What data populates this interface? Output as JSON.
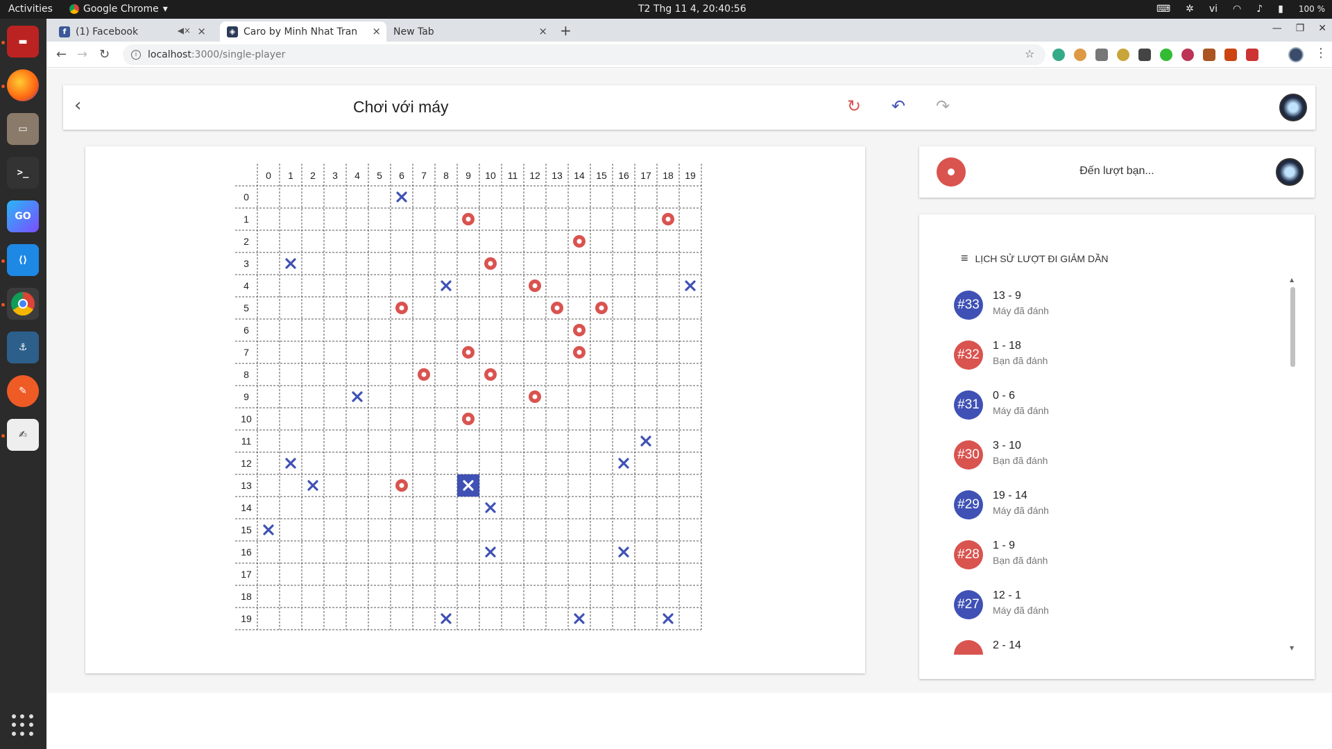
{
  "system": {
    "activities": "Activities",
    "app_name": "Google Chrome",
    "clock": "T2 Thg 11  4, 20:40:56",
    "language": "vi",
    "battery": "100 %"
  },
  "browser": {
    "tabs": [
      {
        "label": "(1) Facebook"
      },
      {
        "label": "Caro by Minh Nhat Tran"
      },
      {
        "label": "New Tab"
      }
    ],
    "url_host": "localhost",
    "url_path": ":3000/single-player"
  },
  "app": {
    "title": "Chơi với máy",
    "turn_text": "Đến lượt bạn...",
    "history_title": "LỊCH SỬ LƯỢT ĐI GIẢM DẦN",
    "colors": {
      "player": "#d9534f",
      "computer": "#3f51b5"
    }
  },
  "board": {
    "size": 20,
    "col_labels": [
      "0",
      "1",
      "2",
      "3",
      "4",
      "5",
      "6",
      "7",
      "8",
      "9",
      "10",
      "11",
      "12",
      "13",
      "14",
      "15",
      "16",
      "17",
      "18",
      "19"
    ],
    "row_labels": [
      "0",
      "1",
      "2",
      "3",
      "4",
      "5",
      "6",
      "7",
      "8",
      "9",
      "10",
      "11",
      "12",
      "13",
      "14",
      "15",
      "16",
      "17",
      "18",
      "19"
    ],
    "pieces": [
      {
        "r": 0,
        "c": 6,
        "p": "X"
      },
      {
        "r": 1,
        "c": 9,
        "p": "O"
      },
      {
        "r": 1,
        "c": 18,
        "p": "O"
      },
      {
        "r": 2,
        "c": 14,
        "p": "O"
      },
      {
        "r": 3,
        "c": 1,
        "p": "X"
      },
      {
        "r": 3,
        "c": 10,
        "p": "O"
      },
      {
        "r": 4,
        "c": 8,
        "p": "X"
      },
      {
        "r": 4,
        "c": 12,
        "p": "O"
      },
      {
        "r": 4,
        "c": 19,
        "p": "X"
      },
      {
        "r": 5,
        "c": 6,
        "p": "O"
      },
      {
        "r": 5,
        "c": 13,
        "p": "O"
      },
      {
        "r": 5,
        "c": 15,
        "p": "O"
      },
      {
        "r": 6,
        "c": 14,
        "p": "O"
      },
      {
        "r": 7,
        "c": 9,
        "p": "O"
      },
      {
        "r": 7,
        "c": 14,
        "p": "O"
      },
      {
        "r": 8,
        "c": 7,
        "p": "O"
      },
      {
        "r": 8,
        "c": 10,
        "p": "O"
      },
      {
        "r": 9,
        "c": 4,
        "p": "X"
      },
      {
        "r": 9,
        "c": 12,
        "p": "O"
      },
      {
        "r": 10,
        "c": 9,
        "p": "O"
      },
      {
        "r": 11,
        "c": 17,
        "p": "X"
      },
      {
        "r": 12,
        "c": 1,
        "p": "X"
      },
      {
        "r": 12,
        "c": 16,
        "p": "X"
      },
      {
        "r": 13,
        "c": 2,
        "p": "X"
      },
      {
        "r": 13,
        "c": 6,
        "p": "O"
      },
      {
        "r": 13,
        "c": 9,
        "p": "X",
        "last": true
      },
      {
        "r": 14,
        "c": 10,
        "p": "X"
      },
      {
        "r": 15,
        "c": 0,
        "p": "X"
      },
      {
        "r": 16,
        "c": 10,
        "p": "X"
      },
      {
        "r": 16,
        "c": 16,
        "p": "X"
      },
      {
        "r": 19,
        "c": 8,
        "p": "X"
      },
      {
        "r": 19,
        "c": 14,
        "p": "X"
      },
      {
        "r": 19,
        "c": 18,
        "p": "X"
      }
    ]
  },
  "history": [
    {
      "num": "#33",
      "move": "13 - 9",
      "who": "Máy đã đánh",
      "player": "computer"
    },
    {
      "num": "#32",
      "move": "1 - 18",
      "who": "Bạn đã đánh",
      "player": "human"
    },
    {
      "num": "#31",
      "move": "0 - 6",
      "who": "Máy đã đánh",
      "player": "computer"
    },
    {
      "num": "#30",
      "move": "3 - 10",
      "who": "Bạn đã đánh",
      "player": "human"
    },
    {
      "num": "#29",
      "move": "19 - 14",
      "who": "Máy đã đánh",
      "player": "computer"
    },
    {
      "num": "#28",
      "move": "1 - 9",
      "who": "Bạn đã đánh",
      "player": "human"
    },
    {
      "num": "#27",
      "move": "12 - 1",
      "who": "Máy đã đánh",
      "player": "computer"
    },
    {
      "num": "",
      "move": "2 - 14",
      "who": "",
      "player": "human"
    }
  ]
}
